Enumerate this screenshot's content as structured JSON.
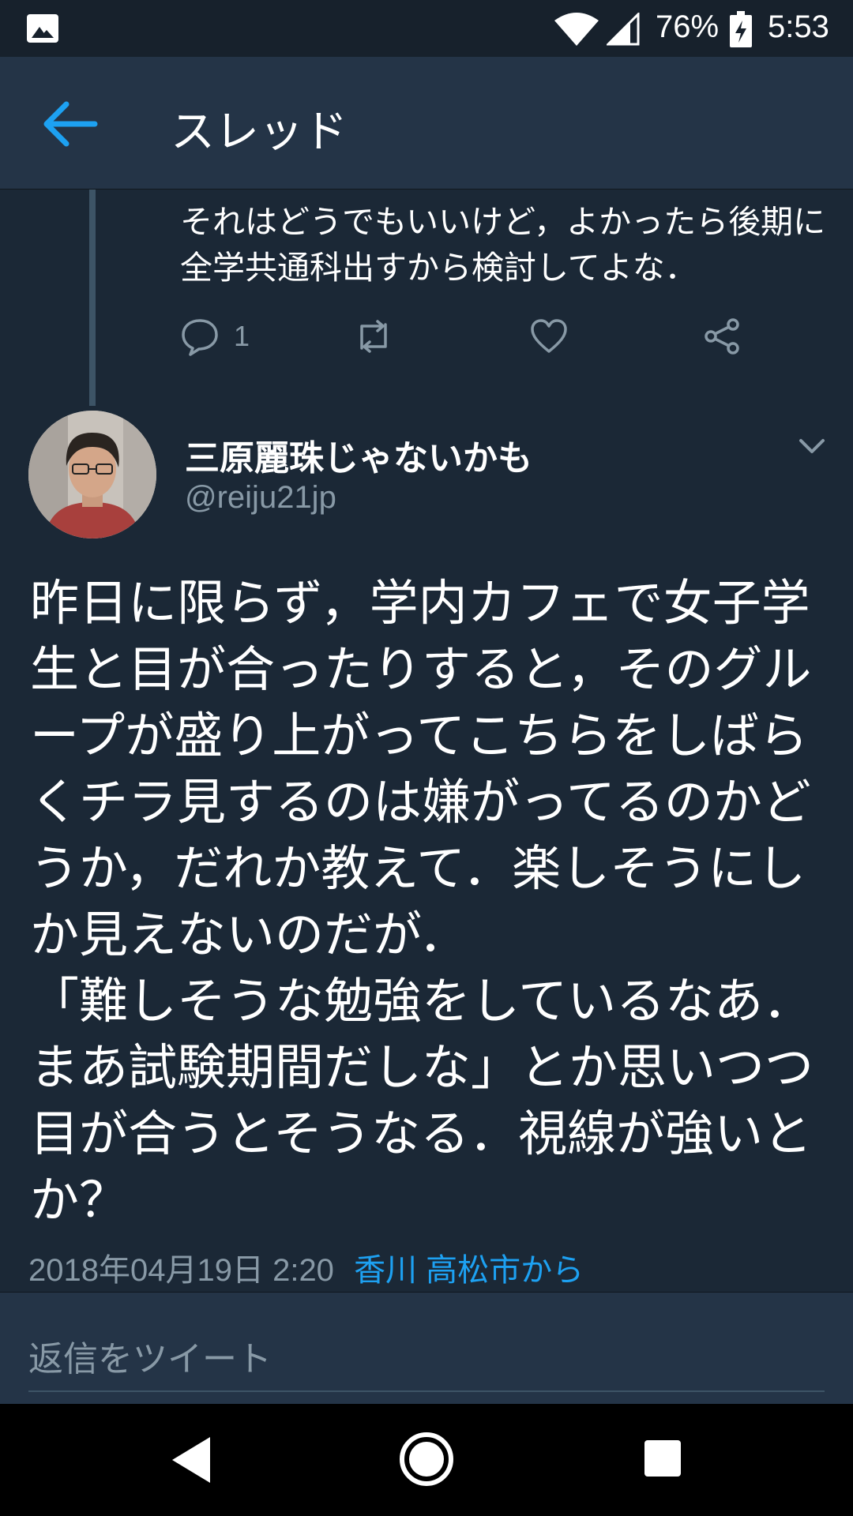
{
  "status_bar": {
    "battery_percent": "76%",
    "time": "5:53",
    "icons": [
      "image-notification-icon",
      "wifi-icon",
      "signal-icon",
      "battery-charging-icon"
    ]
  },
  "header": {
    "title": "スレッド",
    "back_icon": "arrow-left-icon"
  },
  "previous_tweet": {
    "text": "それはどうでもいいけど，よかったら後期に全学共通科出すから検討してよな．",
    "actions": {
      "reply_count": "1",
      "icons": [
        "reply-icon",
        "retweet-icon",
        "like-icon",
        "share-icon"
      ]
    }
  },
  "tweet": {
    "user_name": "三原麗珠じゃないかも",
    "handle": "@reiju21jp",
    "body": "昨日に限らず，学内カフェで女子学生と目が合ったりすると，そのグループが盛り上がってこちらをしばらくチラ見するのは嫌がってるのかどうか，だれか教えて．楽しそうにしか見えないのだが．\n「難しそうな勉強をしているなあ．まあ試験期間だしな」とか思いつつ目が合うとそうなる．視線が強いとか？",
    "timestamp": "2018年04月19日 2:20",
    "location": "香川 高松市から"
  },
  "reply_bar": {
    "placeholder": "返信をツイート"
  },
  "colors": {
    "background": "#1b2836",
    "header": "#243447",
    "accent": "#1da1f2",
    "muted_text": "#8899a6"
  }
}
